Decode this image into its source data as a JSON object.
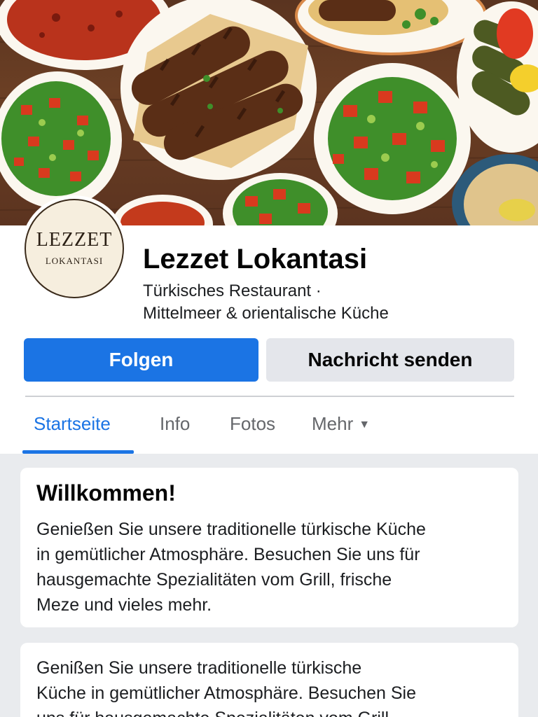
{
  "page": {
    "name": "Lezzet Lokantasi",
    "category_line1": "Türkisches Restaurant ·",
    "category_line2": "Mittelmeer & orientalische Küche"
  },
  "logo": {
    "main": "LEZZET",
    "sub": "LOKANTASI"
  },
  "actions": {
    "follow": "Folgen",
    "message": "Nachricht senden"
  },
  "tabs": [
    {
      "label": "Startseite",
      "active": true
    },
    {
      "label": "Info",
      "active": false
    },
    {
      "label": "Fotos",
      "active": false
    },
    {
      "label": "Mehr",
      "active": false
    }
  ],
  "icons": {
    "more_caret": "caret-down-icon"
  },
  "posts": [
    {
      "title": "Willkommen!",
      "lines": [
        "Genießen Sie unsere traditionelle türkische Küche",
        "in gemütlicher Atmosphäre. Besuchen Sie uns für",
        "hausgemachte Spezialitäten vom Grill, frische",
        "Meze und vieles mehr."
      ]
    },
    {
      "lines": [
        "Genißen Sie unsere traditionelle türkische",
        "Küche in gemütlicher Atmosphäre. Besuchen Sie",
        "uns für hausgemachte Spezialitäten vom Grill"
      ]
    }
  ],
  "colors": {
    "brand_blue": "#1b74e4",
    "secondary_button": "#e4e6eb",
    "page_background": "#e9ebee"
  }
}
